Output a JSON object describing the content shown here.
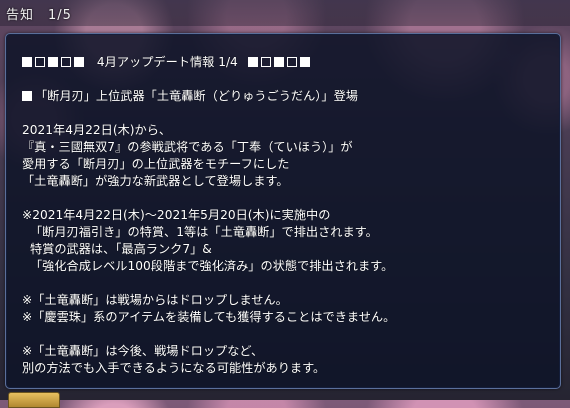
{
  "window": {
    "title": "告知",
    "page": "1/5"
  },
  "notice": {
    "header_title": "4月アップデート情報 1/4",
    "headline": "「断月刃」上位武器「土竜轟断（どりゅうごうだん）」登場",
    "lines": [
      "2021年4月22日(木)から、",
      "『真・三國無双7』の参戦武将である「丁奉（ていほう）」が",
      "愛用する「断月刃」の上位武器をモチーフにした",
      "「土竜轟断」が強力な新武器として登場します。",
      "※2021年4月22日(木)～2021年5月20日(木)に実施中の",
      "「断月刃福引き」の特賞、1等は「土竜轟断」で排出されます。",
      "特賞の武器は、「最高ランク7」&",
      "「強化合成レベル100段階まで強化済み」の状態で排出されます。",
      "※「土竜轟断」は戦場からはドロップしません。",
      "※「慶雲珠」系のアイテムを装備しても獲得することはできません。",
      "※「土竜轟断」は今後、戦場ドロップなど、",
      "別の方法でも入手できるようになる可能性があります。"
    ]
  },
  "colors": {
    "panel_bg": "#0e1428",
    "panel_border": "#5b6f9a",
    "text": "#ffffff"
  }
}
